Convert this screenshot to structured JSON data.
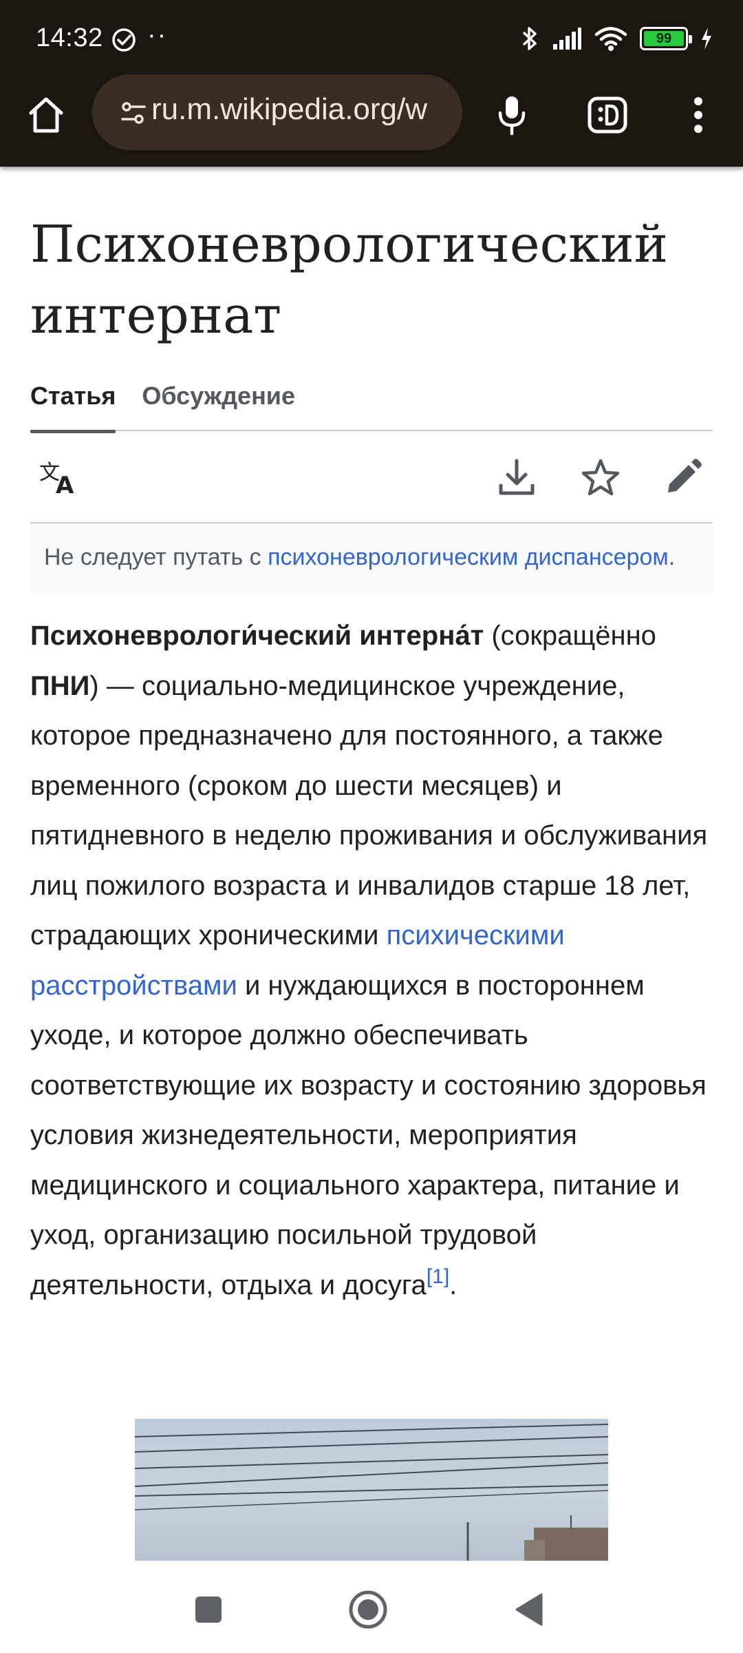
{
  "status_bar": {
    "time": "14:32",
    "dots": "··",
    "battery_level": "99",
    "icons": [
      "sync-icon",
      "bluetooth-icon",
      "signal-icon",
      "wifi-icon",
      "battery-icon",
      "charging-icon"
    ]
  },
  "browser": {
    "url": "ru.m.wikipedia.org/w",
    "icons": [
      "home-icon",
      "site-settings-icon",
      "mic-icon",
      "extension-icon",
      "more-menu-icon"
    ]
  },
  "article": {
    "title": "Психоневрологический интернат",
    "tabs": [
      {
        "label": "Статья",
        "active": true
      },
      {
        "label": "Обсуждение",
        "active": false
      }
    ],
    "actions": [
      "language-icon",
      "download-icon",
      "watch-star-icon",
      "edit-pencil-icon"
    ],
    "hatnote": {
      "prefix": "Не следует путать с ",
      "link": "психоневрологическим диспансером",
      "suffix": "."
    },
    "lead": {
      "bold_term": "Психоневрологи́ческий интерна́т",
      "part1": " (сокращённо ",
      "abbr": "ПНИ",
      "part2": ") — социально-медицинское учреждение, которое предназначено для постоянного, а также временного (сроком до шести месяцев) и пятидневного в неделю проживания и обслуживания лиц пожилого возраста и инвалидов старше 18 лет, страдающих хроническими ",
      "link": "психическими расстройствами",
      "part3": " и нуждающихся в постороннем уходе, и которое должно обеспечивать соответствующие их возрасту и состоянию здоровья условия жизнедеятельности, мероприятия медицинского и социального характера, питание и уход, организацию посильной трудовой деятельности, отдыха и досуга",
      "ref": "[1]",
      "end": "."
    }
  },
  "colors": {
    "chrome_bg": "#1c1610",
    "urlbar_bg": "#3a2e22",
    "link": "#3366cc",
    "text": "#202122",
    "battery": "#27c93f"
  },
  "nav": {
    "icons": [
      "recents-square-icon",
      "home-circle-icon",
      "back-triangle-icon"
    ]
  }
}
